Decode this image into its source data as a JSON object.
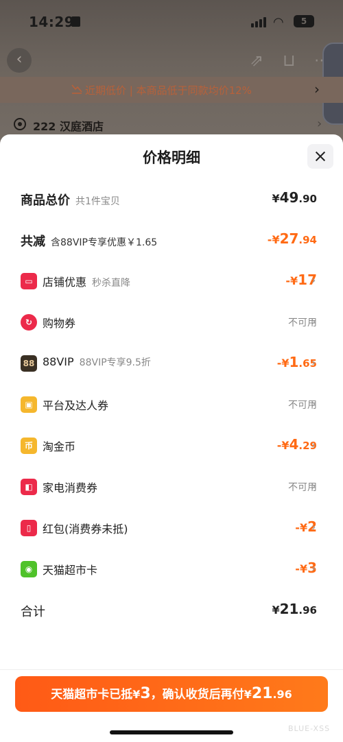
{
  "status_bar": {
    "time": "14:29",
    "battery": "5"
  },
  "nav": {
    "back_icon": "chevron-left-icon",
    "side_tab_icon": "chevron-left-icon"
  },
  "banner": {
    "text": "近期低价 | 本商品低于同款均价12%"
  },
  "address": {
    "text": "222 汉庭酒店"
  },
  "sheet": {
    "title": "价格明细",
    "summary": {
      "total_label": "商品总价",
      "total_sub": "共1件宝贝",
      "total_currency": "¥",
      "total_int": "49",
      "total_dec": ".90",
      "discount_label": "共减",
      "discount_sub": "含88VIP专享优惠￥1.65",
      "discount_prefix": "-¥",
      "discount_int": "27",
      "discount_dec": ".94"
    },
    "items": [
      {
        "label": "店铺优惠",
        "sub": "秒杀直降",
        "icon": "store-icon",
        "color": "#ec2a4a",
        "prefix": "-¥",
        "int": "17",
        "dec": "",
        "status": ""
      },
      {
        "label": "购物券",
        "sub": "",
        "icon": "coupon-icon",
        "color": "#ec2a4a",
        "prefix": "",
        "int": "",
        "dec": "",
        "status": "不可用"
      },
      {
        "label": "88VIP",
        "sub": "88VIP专享9.5折",
        "icon": "vip88-icon",
        "icon_text": "88",
        "color": "#3a3024",
        "prefix": "-¥",
        "int": "1",
        "dec": ".65",
        "status": ""
      },
      {
        "label": "平台及达人券",
        "sub": "",
        "icon": "gift-icon",
        "color": "#f5b72d",
        "prefix": "",
        "int": "",
        "dec": "",
        "status": "不可用"
      },
      {
        "label": "淘金币",
        "sub": "",
        "icon": "coin-icon",
        "icon_text": "币",
        "color": "#f5b72d",
        "prefix": "-¥",
        "int": "4",
        "dec": ".29",
        "status": ""
      },
      {
        "label": "家电消费券",
        "sub": "",
        "icon": "appliance-coupon-icon",
        "color": "#ec2a4a",
        "prefix": "",
        "int": "",
        "dec": "",
        "status": "不可用"
      },
      {
        "label": "红包(消费券未抵)",
        "sub": "",
        "icon": "red-packet-icon",
        "color": "#ec2a4a",
        "prefix": "-¥",
        "int": "2",
        "dec": "",
        "status": ""
      },
      {
        "label": "天猫超市卡",
        "sub": "",
        "icon": "tmall-card-icon",
        "color": "#4fc22a",
        "prefix": "-¥",
        "int": "3",
        "dec": "",
        "status": ""
      }
    ],
    "total": {
      "label": "合计",
      "currency": "¥",
      "int": "21",
      "dec": ".96"
    }
  },
  "pay_button": {
    "part1": "天猫超市卡已抵",
    "cur1": "¥",
    "num1": "3",
    "part2": "，确认收货后再付",
    "cur2": "¥",
    "num2": "21",
    "dec2": ".96"
  },
  "watermark": "BLUE-XSS"
}
